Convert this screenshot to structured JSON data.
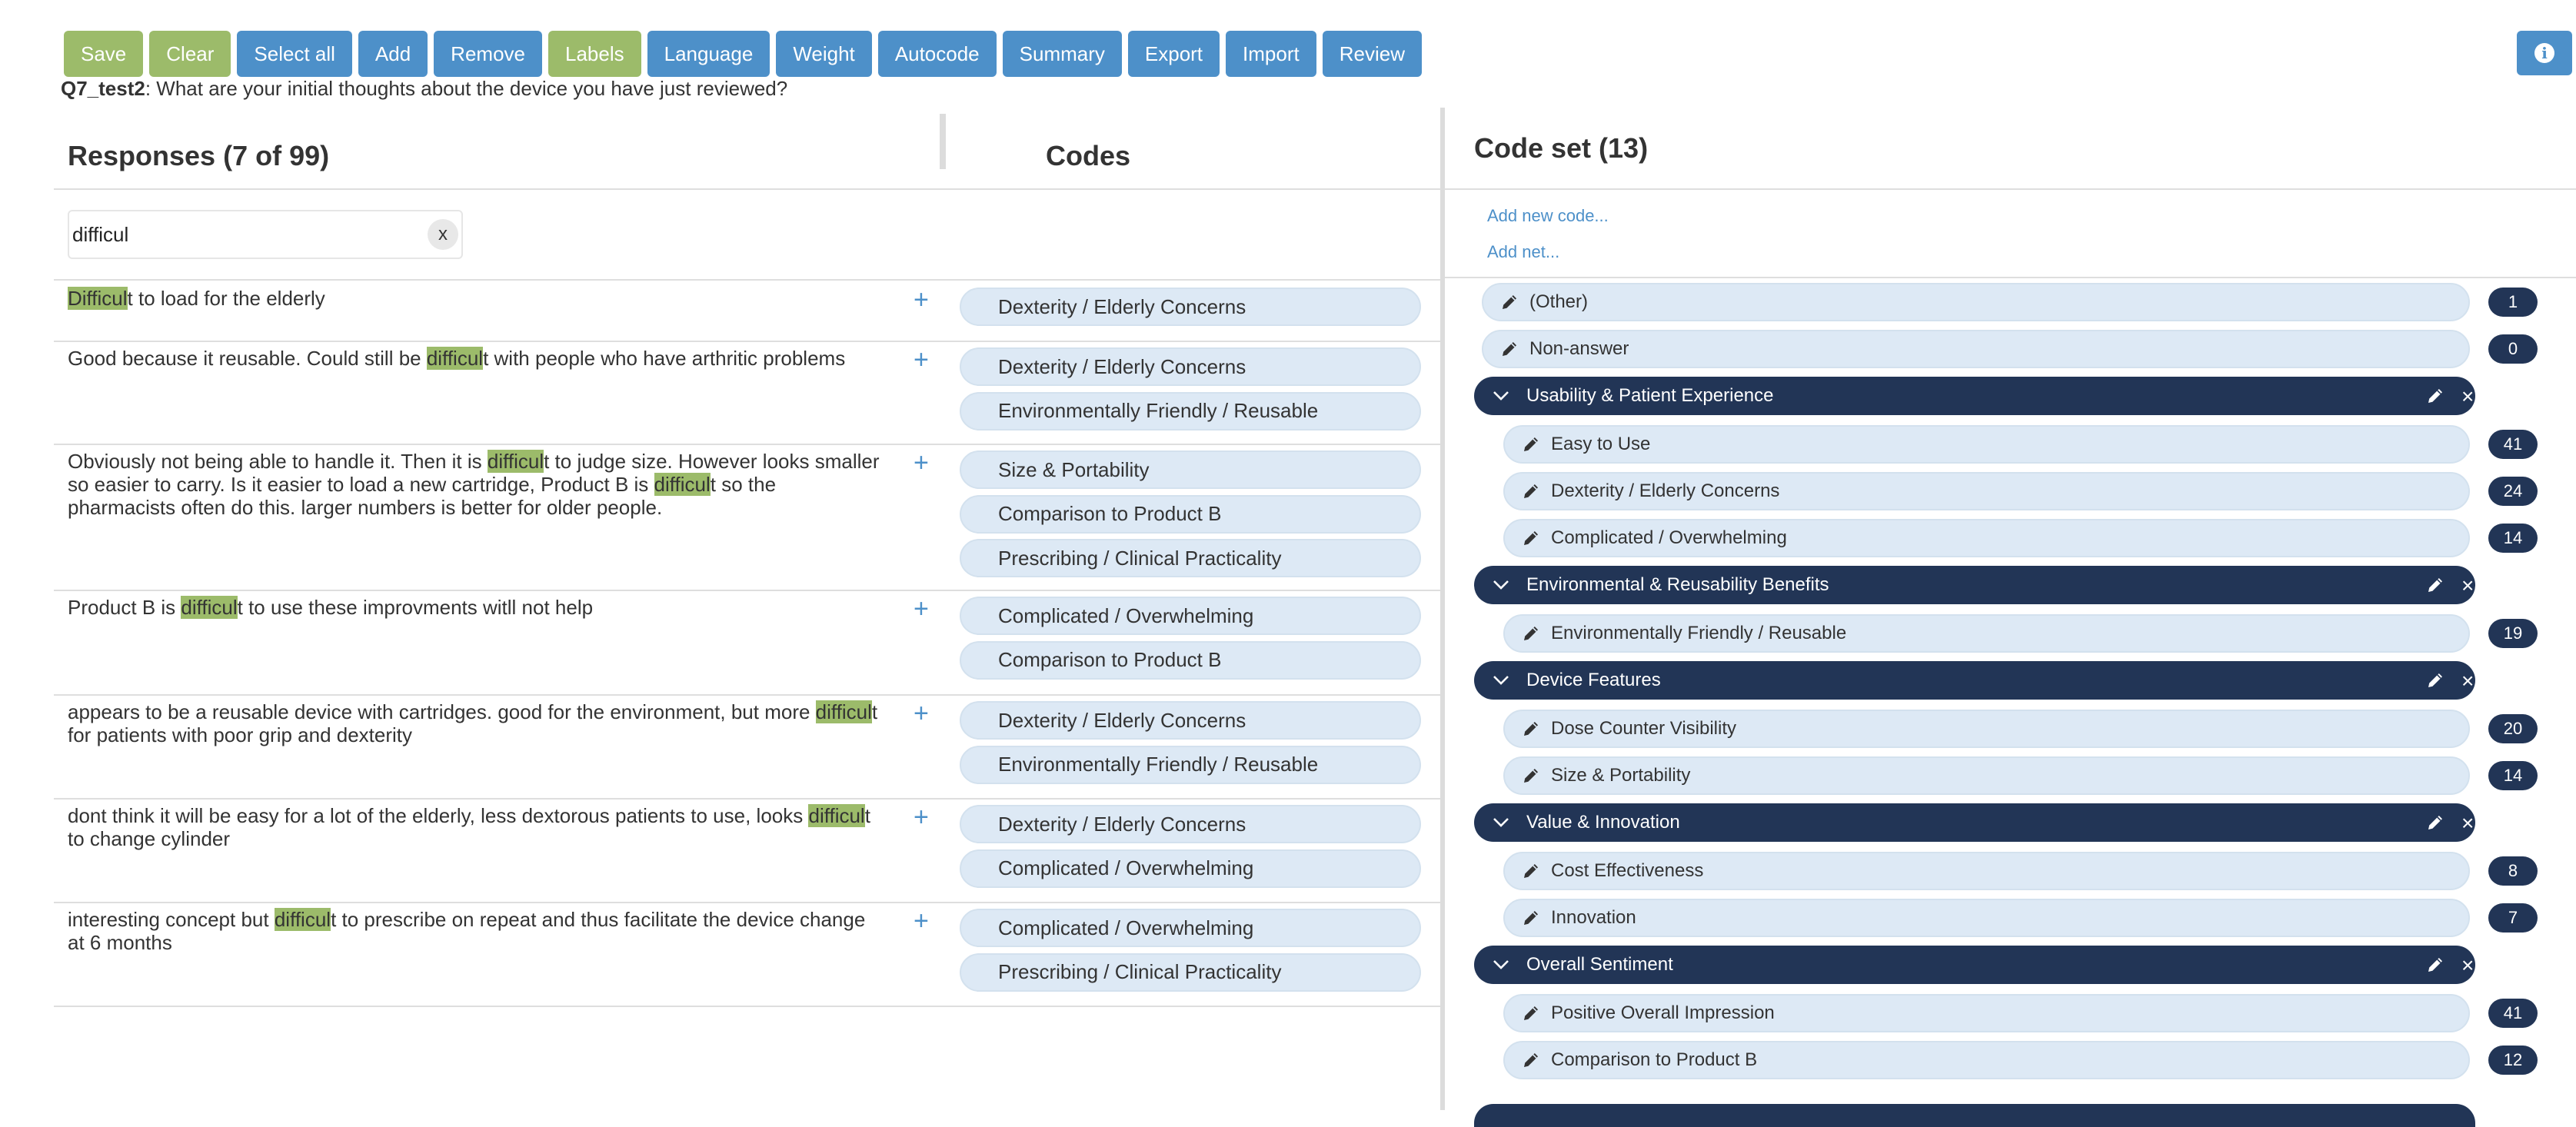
{
  "toolbar": {
    "buttons": [
      "Save",
      "Clear",
      "Select all",
      "Add",
      "Remove",
      "Labels",
      "Language",
      "Weight",
      "Autocode",
      "Summary",
      "Export",
      "Import",
      "Review"
    ],
    "colors": {
      "green": "#9cbb6a",
      "blue": "#4d90c9"
    }
  },
  "question": {
    "id": "Q7_test2",
    "text": ": What are your initial thoughts about the device you have just reviewed?"
  },
  "responses_panel": {
    "title": "Responses (7 of 99)",
    "codes_header": "Codes",
    "search_value": "difficul",
    "clear_label": "x"
  },
  "responses": [
    {
      "lines": [
        [
          [
            "Difficul",
            true
          ],
          [
            "t to load for the elderly",
            false
          ]
        ]
      ],
      "codes": [
        "Dexterity / Elderly Concerns"
      ]
    },
    {
      "lines": [
        [
          [
            "Good because it reusable. Could still be ",
            false
          ],
          [
            "difficul",
            true
          ],
          [
            "t with people who have arthritic problems",
            false
          ]
        ]
      ],
      "codes": [
        "Dexterity / Elderly Concerns",
        "Environmentally Friendly / Reusable"
      ]
    },
    {
      "lines": [
        [
          [
            "Obviously not being able to handle it. Then it is ",
            false
          ],
          [
            "difficul",
            true
          ],
          [
            "t to judge size. However looks smaller",
            false
          ]
        ],
        [
          [
            "so easier to carry. Is it easier to load a new cartridge, Product B is ",
            false
          ],
          [
            "difficul",
            true
          ],
          [
            "t so the",
            false
          ]
        ],
        [
          [
            "pharmacists often do this. larger numbers is better for older people.",
            false
          ]
        ]
      ],
      "codes": [
        "Size & Portability",
        "Comparison to Product B",
        "Prescribing / Clinical Practicality"
      ]
    },
    {
      "lines": [
        [
          [
            "Product B is ",
            false
          ],
          [
            "difficul",
            true
          ],
          [
            "t to use these improvments witll not help",
            false
          ]
        ]
      ],
      "codes": [
        "Complicated / Overwhelming",
        "Comparison to Product B"
      ]
    },
    {
      "lines": [
        [
          [
            "appears to be a reusable device with cartridges. good for the environment, but more ",
            false
          ],
          [
            "difficul",
            true
          ],
          [
            "t",
            false
          ]
        ],
        [
          [
            "for patients with poor grip and dexterity",
            false
          ]
        ]
      ],
      "codes": [
        "Dexterity / Elderly Concerns",
        "Environmentally Friendly / Reusable"
      ]
    },
    {
      "lines": [
        [
          [
            "dont think it will be easy for a lot of the elderly, less dextorous patients to use, looks ",
            false
          ],
          [
            "difficul",
            true
          ],
          [
            "t",
            false
          ]
        ],
        [
          [
            "to change cylinder",
            false
          ]
        ]
      ],
      "codes": [
        "Dexterity / Elderly Concerns",
        "Complicated / Overwhelming"
      ]
    },
    {
      "lines": [
        [
          [
            "interesting concept but ",
            false
          ],
          [
            "difficul",
            true
          ],
          [
            "t to prescribe on repeat and thus facilitate the device change",
            false
          ]
        ],
        [
          [
            "at 6 months",
            false
          ]
        ]
      ],
      "codes": [
        "Complicated / Overwhelming",
        "Prescribing / Clinical Practicality"
      ]
    }
  ],
  "codeset": {
    "title": "Code set (13)",
    "add_code": "Add new code...",
    "add_net": "Add net...",
    "items": [
      {
        "kind": "code",
        "label": "(Other)",
        "count": "1",
        "indent": false
      },
      {
        "kind": "code",
        "label": "Non-answer",
        "count": "0",
        "indent": false
      },
      {
        "kind": "group",
        "label": "Usability & Patient Experience"
      },
      {
        "kind": "code",
        "label": "Easy to Use",
        "count": "41",
        "indent": true
      },
      {
        "kind": "code",
        "label": "Dexterity / Elderly Concerns",
        "count": "24",
        "indent": true
      },
      {
        "kind": "code",
        "label": "Complicated / Overwhelming",
        "count": "14",
        "indent": true
      },
      {
        "kind": "group",
        "label": "Environmental & Reusability Benefits"
      },
      {
        "kind": "code",
        "label": "Environmentally Friendly / Reusable",
        "count": "19",
        "indent": true
      },
      {
        "kind": "group",
        "label": "Device Features"
      },
      {
        "kind": "code",
        "label": "Dose Counter Visibility",
        "count": "20",
        "indent": true
      },
      {
        "kind": "code",
        "label": "Size & Portability",
        "count": "14",
        "indent": true
      },
      {
        "kind": "group",
        "label": "Value & Innovation"
      },
      {
        "kind": "code",
        "label": "Cost Effectiveness",
        "count": "8",
        "indent": true
      },
      {
        "kind": "code",
        "label": "Innovation",
        "count": "7",
        "indent": true
      },
      {
        "kind": "group",
        "label": "Overall Sentiment"
      },
      {
        "kind": "code",
        "label": "Positive Overall Impression",
        "count": "41",
        "indent": true
      },
      {
        "kind": "code",
        "label": "Comparison to Product B",
        "count": "12",
        "indent": true
      }
    ],
    "colors": {
      "group": "#223556",
      "code_bg": "#dde9f5",
      "link": "#4d90c9"
    }
  }
}
